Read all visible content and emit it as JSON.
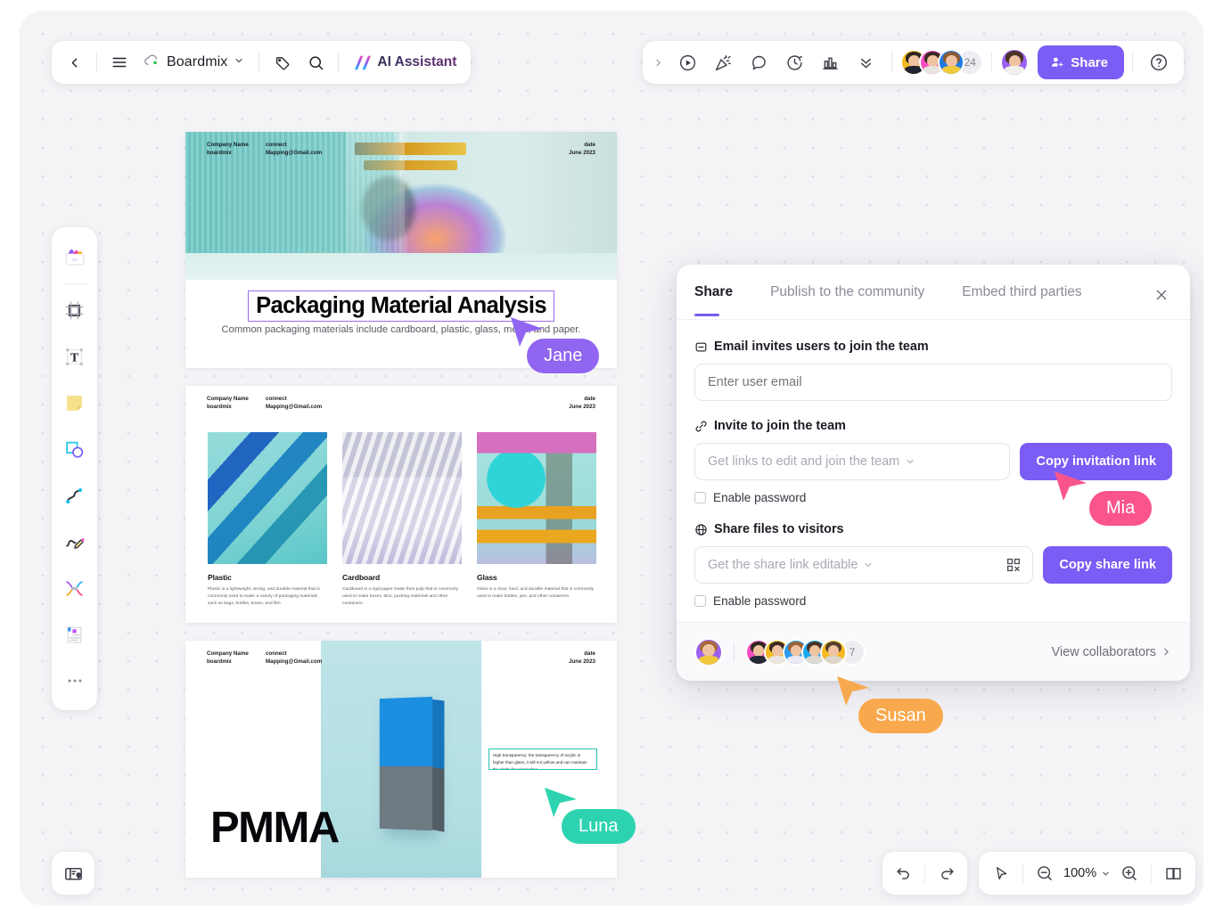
{
  "app": {
    "doc_name": "Boardmix",
    "ai_assistant_label": "AI Assistant"
  },
  "top_left_toolbar": {
    "items": [
      {
        "name": "back-button",
        "icon": "chevron-left-icon"
      },
      {
        "name": "menu-button",
        "icon": "hamburger-menu-icon"
      },
      {
        "name": "tag-button",
        "icon": "tag-icon"
      },
      {
        "name": "search-button",
        "icon": "search-icon"
      }
    ]
  },
  "top_right_toolbar": {
    "expand_icon": "chevron-right-icon",
    "items": [
      {
        "name": "present-button",
        "icon": "play-circle-icon"
      },
      {
        "name": "celebrate-button",
        "icon": "party-popper-icon"
      },
      {
        "name": "comment-button",
        "icon": "speech-bubble-icon"
      },
      {
        "name": "timer-button",
        "icon": "timer-icon"
      },
      {
        "name": "vote-button",
        "icon": "bar-chart-icon"
      },
      {
        "name": "more-button",
        "icon": "double-chevron-down-icon"
      }
    ],
    "avatar_overflow_count": "24",
    "share_label": "Share",
    "help_icon": "question-circle-icon"
  },
  "left_rail": {
    "items": [
      {
        "name": "templates-tool",
        "icon": "templates-icon"
      },
      {
        "name": "frame-tool",
        "icon": "frame-icon"
      },
      {
        "name": "text-tool",
        "icon": "text-T-icon"
      },
      {
        "name": "sticky-note-tool",
        "icon": "sticky-note-icon"
      },
      {
        "name": "shapes-tool",
        "icon": "shapes-icon"
      },
      {
        "name": "connector-tool",
        "icon": "curve-connector-icon"
      },
      {
        "name": "pen-tool",
        "icon": "pen-scribble-icon"
      },
      {
        "name": "mindmap-tool",
        "icon": "mindmap-icon"
      },
      {
        "name": "document-tool",
        "icon": "document-icon"
      },
      {
        "name": "more-tools",
        "icon": "ellipsis-icon"
      }
    ]
  },
  "bottom_bar": {
    "minimap_icon": "minimap-location-icon",
    "undo_icon": "undo-arrow-icon",
    "redo_icon": "redo-arrow-icon",
    "select_icon": "cursor-arrow-icon",
    "zoom_out_icon": "zoom-out-icon",
    "zoom_in_icon": "zoom-in-icon",
    "zoom_level": "100%",
    "pages_icon": "open-book-icon"
  },
  "slides": {
    "header": {
      "company_label": "Company Name",
      "company_value": "boardmix",
      "connect_label": "connect",
      "connect_value": "Mapping@Gmail.com",
      "date_label": "date",
      "date_value": "June 2023"
    },
    "slide1": {
      "title": "Packaging Material Analysis",
      "subtitle": "Common packaging materials include cardboard, plastic, glass, metal, and paper."
    },
    "slide2": {
      "cards": [
        {
          "title": "Plastic",
          "desc": "Plastic is a lightweight, strong, and durable material that is commonly used to make a variety of packaging materials such as bags, bottles, boxes, and film."
        },
        {
          "title": "Cardboard",
          "desc": "Cardboard is a rigid paper made from pulp that is commonly used to make boxes, bins, packing materials and other containers."
        },
        {
          "title": "Glass",
          "desc": "Glass is a clear, hard, and durable material that is commonly used to make bottles, jars, and other containers."
        }
      ]
    },
    "slide3": {
      "title": "PMMA",
      "note": "High transparency: the transparency of acrylic is higher than glass, it will not yellow and can maintain the clarity for a long time."
    }
  },
  "share_dialog": {
    "tabs": [
      {
        "label": "Share",
        "active": true
      },
      {
        "label": "Publish to the community",
        "active": false
      },
      {
        "label": "Embed third parties",
        "active": false
      }
    ],
    "close_icon": "close-x-icon",
    "email_section": {
      "icon": "minus-square-icon",
      "label": "Email invites users to join the team",
      "input_placeholder": "Enter user email",
      "input_value": ""
    },
    "invite_section": {
      "icon": "link-icon",
      "label": "Invite to join the team",
      "select_value": "Get links to edit and join the team",
      "button_label": "Copy invitation link",
      "checkbox_label": "Enable password",
      "checked": false
    },
    "visitors_section": {
      "icon": "globe-icon",
      "label": "Share files to visitors",
      "select_value": "Get the share link editable",
      "qr_icon": "qr-code-icon",
      "button_label": "Copy share link",
      "checkbox_label": "Enable password",
      "checked": false
    },
    "footer": {
      "collaborator_overflow_count": "7",
      "view_collaborators_label": "View collaborators",
      "view_collaborators_icon": "chevron-right-icon"
    }
  },
  "cursors": [
    {
      "name": "Jane",
      "color": "#9065F0"
    },
    {
      "name": "Mia",
      "color": "#F9558A"
    },
    {
      "name": "Susan",
      "color": "#F9A94D"
    },
    {
      "name": "Luna",
      "color": "#2DD3B0"
    }
  ],
  "colors": {
    "accent": "#7b5cf5",
    "canvas_bg": "#f4f4f7",
    "dot": "#dcdce4",
    "selection_purple": "#9c6cf0",
    "selection_teal": "#23c6ac"
  }
}
